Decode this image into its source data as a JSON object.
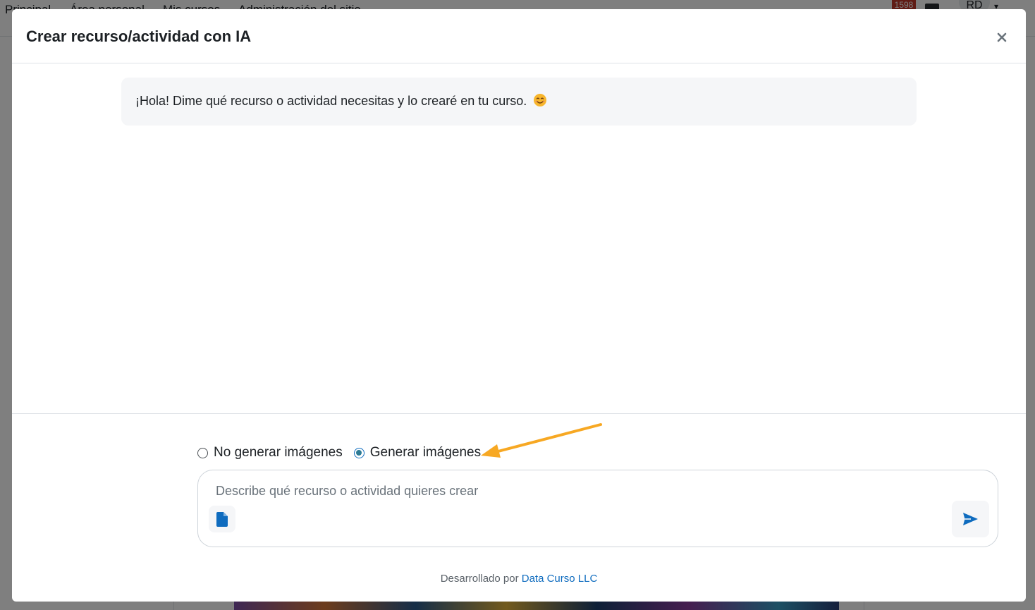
{
  "background": {
    "nav_items": [
      "Principal",
      "Área personal",
      "Mis cursos",
      "Administración del sitio"
    ],
    "notification_count": "1598",
    "user_initials": "RD"
  },
  "modal": {
    "title": "Crear recurso/actividad con IA",
    "close_label": "×",
    "bot_message": "¡Hola! Dime qué recurso o actividad necesitas y lo crearé en tu curso.",
    "bot_emoji": "smiling-face-emoji",
    "image_options": [
      {
        "label": "No generar imágenes",
        "checked": false
      },
      {
        "label": "Generar imágenes",
        "checked": true
      }
    ],
    "input": {
      "placeholder": "Describe qué recurso o actividad quieres crear",
      "value": ""
    },
    "credit_prefix": "Desarrollado por",
    "credit_link": "Data Curso LLC"
  },
  "colors": {
    "accent": "#0f6cbf",
    "radio_checked": "#2c7b95",
    "annotation_arrow": "#f7a823",
    "message_bg": "#f5f6f8"
  },
  "icons": {
    "attach": "file-icon",
    "send": "send-icon",
    "close": "close-icon"
  }
}
